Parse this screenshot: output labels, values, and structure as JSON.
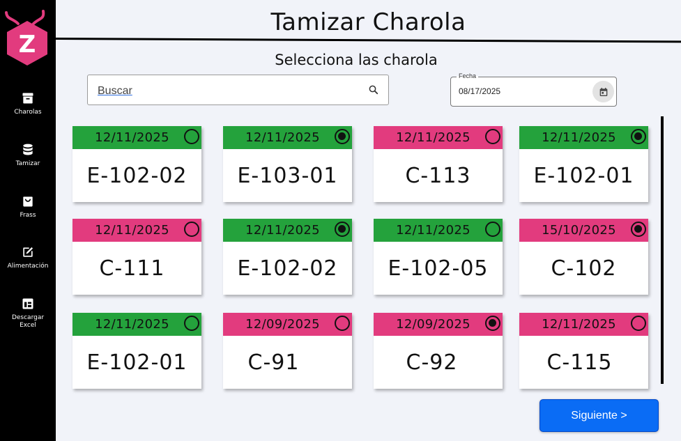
{
  "app": {
    "logo_letter": "Z",
    "title": "Tamizar Charola",
    "subtitle": "Selecciona las charola"
  },
  "sidebar": {
    "items": [
      {
        "label": "Charolas",
        "icon": "archive-icon"
      },
      {
        "label": "Tamizar",
        "icon": "database-icon"
      },
      {
        "label": "Frass",
        "icon": "bag-icon"
      },
      {
        "label": "Alimentación",
        "icon": "edit-icon"
      },
      {
        "label": "Descargar Excel",
        "icon": "table-icon"
      }
    ]
  },
  "search": {
    "placeholder": "Buscar",
    "value": ""
  },
  "date_field": {
    "label": "Fecha",
    "value": "08/17/2025"
  },
  "colors": {
    "green": "#24a23c",
    "pink": "#e23b7e",
    "primary": "#0a6cf5"
  },
  "cards": [
    {
      "date": "12/11/2025",
      "code": "E-102-02",
      "color": "green",
      "selected": false
    },
    {
      "date": "12/11/2025",
      "code": "E-103-01",
      "color": "green",
      "selected": true
    },
    {
      "date": "12/11/2025",
      "code": "C-113",
      "color": "pink",
      "selected": false
    },
    {
      "date": "12/11/2025",
      "code": "E-102-01",
      "color": "green",
      "selected": true
    },
    {
      "date": "12/11/2025",
      "code": "C-111",
      "color": "pink",
      "selected": false
    },
    {
      "date": "12/11/2025",
      "code": "E-102-02",
      "color": "green",
      "selected": true
    },
    {
      "date": "12/11/2025",
      "code": "E-102-05",
      "color": "green",
      "selected": false
    },
    {
      "date": "15/10/2025",
      "code": "C-102",
      "color": "pink",
      "selected": true
    },
    {
      "date": "12/11/2025",
      "code": "E-102-01",
      "color": "green",
      "selected": false
    },
    {
      "date": "12/09/2025",
      "code": "C-91",
      "color": "pink",
      "selected": false
    },
    {
      "date": "12/09/2025",
      "code": "C-92",
      "color": "pink",
      "selected": true
    },
    {
      "date": "12/11/2025",
      "code": "C-115",
      "color": "pink",
      "selected": false
    }
  ],
  "actions": {
    "next_label": "Siguiente >"
  }
}
